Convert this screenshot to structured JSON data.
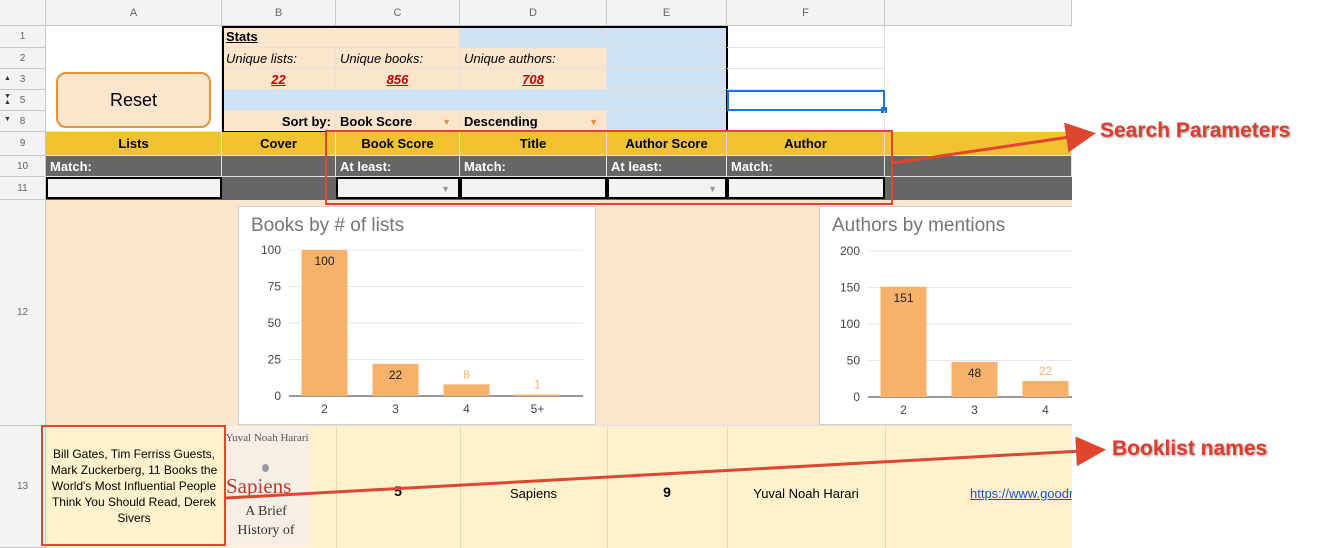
{
  "columns": [
    "A",
    "B",
    "C",
    "D",
    "E",
    "F"
  ],
  "rows": [
    "1",
    "2",
    "3",
    "5",
    "8",
    "9",
    "10",
    "11",
    "12",
    "13"
  ],
  "stats": {
    "title": "Stats",
    "unique_lists_label": "Unique lists:",
    "unique_books_label": "Unique books:",
    "unique_authors_label": "Unique authors:",
    "unique_lists": "22",
    "unique_books": "856",
    "unique_authors": "708"
  },
  "reset_label": "Reset",
  "sort": {
    "label": "Sort by:",
    "field": "Book Score",
    "order": "Descending"
  },
  "headers": {
    "lists": "Lists",
    "cover": "Cover",
    "book_score": "Book Score",
    "title": "Title",
    "author_score": "Author Score",
    "author": "Author"
  },
  "filters": {
    "lists": "Match:",
    "book_score": "At least:",
    "title": "Match:",
    "author_score": "At least:",
    "author": "Match:"
  },
  "chart_data": [
    {
      "type": "bar",
      "title": "Books by # of lists",
      "categories": [
        "2",
        "3",
        "4",
        "5+"
      ],
      "values": [
        100,
        22,
        8,
        1
      ],
      "ylim": [
        0,
        100
      ],
      "yticks": [
        0,
        25,
        50,
        75,
        100
      ],
      "color": "#f6b26b"
    },
    {
      "type": "bar",
      "title": "Authors by mentions",
      "categories": [
        "2",
        "3",
        "4"
      ],
      "values": [
        151,
        48,
        22
      ],
      "ylim": [
        0,
        200
      ],
      "yticks": [
        0,
        50,
        100,
        150,
        200
      ],
      "color": "#f6b26b"
    }
  ],
  "book_row": {
    "lists": "Bill Gates, Tim Ferriss Guests, Mark Zuckerberg, 11 Books the World's Most Influential People Think You Should Read, Derek Sivers",
    "cover_author": "Yuval Noah Harari",
    "cover_title": "Sapiens",
    "cover_subtitle": "A Brief History of",
    "book_score": "5",
    "title": "Sapiens",
    "author_score": "9",
    "author": "Yuval Noah Harari",
    "link": "https://www.goodr"
  },
  "callouts": {
    "search": "Search Parameters",
    "booklist": "Booklist names"
  },
  "colors": {
    "peach": "#fce5cd",
    "blue": "#cfe2f3",
    "header_yellow": "#f1c232",
    "filter_gray": "#666666",
    "bar": "#f6b26b",
    "annotation_red": "#e0452f"
  }
}
